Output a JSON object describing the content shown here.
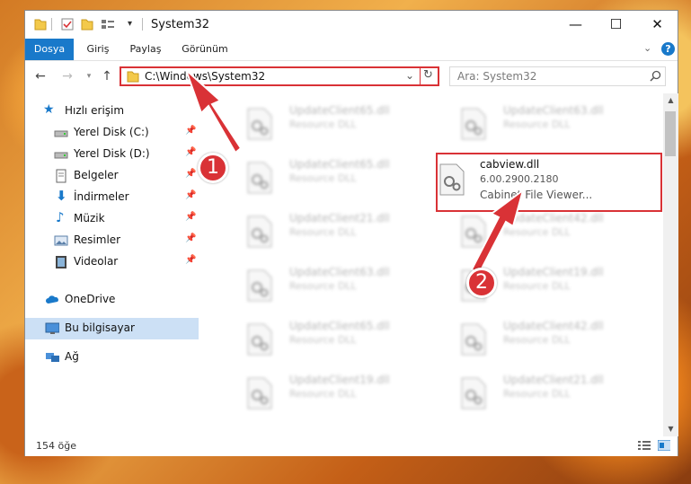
{
  "window": {
    "title": "System32"
  },
  "ribbon": {
    "tabs": [
      "Dosya",
      "Giriş",
      "Paylaş",
      "Görünüm"
    ],
    "active_index": 0
  },
  "address": {
    "path": "C:\\Windows\\System32"
  },
  "search": {
    "placeholder": "Ara: System32"
  },
  "sidebar": {
    "items": [
      {
        "label": "Hızlı erişim",
        "icon": "star-icon"
      },
      {
        "label": "Yerel Disk (C:)",
        "icon": "drive-icon",
        "pinned": true
      },
      {
        "label": "Yerel Disk (D:)",
        "icon": "drive-icon",
        "pinned": true
      },
      {
        "label": "Belgeler",
        "icon": "documents-icon",
        "pinned": true
      },
      {
        "label": "İndirmeler",
        "icon": "download-icon",
        "pinned": true
      },
      {
        "label": "Müzik",
        "icon": "music-icon",
        "pinned": true
      },
      {
        "label": "Resimler",
        "icon": "pictures-icon",
        "pinned": true
      },
      {
        "label": "Videolar",
        "icon": "video-icon",
        "pinned": true
      },
      {
        "label": "OneDrive",
        "icon": "cloud-icon"
      },
      {
        "label": "Bu bilgisayar",
        "icon": "computer-icon",
        "selected": true
      },
      {
        "label": "Ağ",
        "icon": "network-icon"
      }
    ]
  },
  "files": [
    {
      "name": "UpdateClient65.dll",
      "desc": "Resource DLL"
    },
    {
      "name": "UpdateClient63.dll",
      "desc": "Resource DLL"
    },
    {
      "name": "UpdateClient65.dll",
      "desc": "Resource DLL"
    },
    {
      "name": "cabview.dll",
      "desc": "6.00.2900.2180",
      "desc2": "Cabinet File Viewer...",
      "highlight": true
    },
    {
      "name": "UpdateClient21.dll",
      "desc": "Resource DLL"
    },
    {
      "name": "UpdateClient42.dll",
      "desc": "Resource DLL"
    },
    {
      "name": "UpdateClient63.dll",
      "desc": "Resource DLL"
    },
    {
      "name": "UpdateClient19.dll",
      "desc": "Resource DLL"
    },
    {
      "name": "UpdateClient65.dll",
      "desc": "Resource DLL"
    },
    {
      "name": "UpdateClient42.dll",
      "desc": "Resource DLL"
    },
    {
      "name": "UpdateClient19.dll",
      "desc": "Resource DLL"
    },
    {
      "name": "UpdateClient21.dll",
      "desc": "Resource DLL"
    }
  ],
  "status": {
    "count": "154 öğe"
  },
  "callouts": [
    "1",
    "2"
  ],
  "colors": {
    "accent": "#1979ca",
    "highlight": "#d93236",
    "selection": "#cce0f5"
  }
}
